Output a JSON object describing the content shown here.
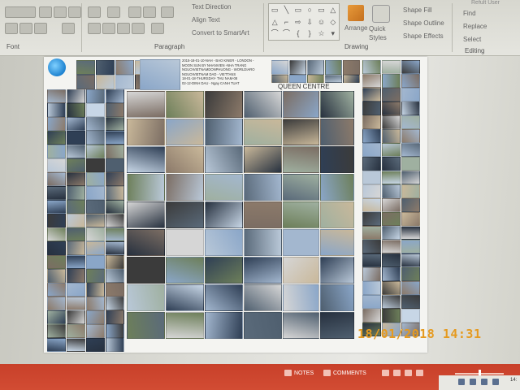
{
  "window": {
    "account_label": "Refult User"
  },
  "ribbon": {
    "groups": {
      "font": "Font",
      "paragraph": "Paragraph",
      "drawing": "Drawing",
      "editing": "Editing"
    },
    "paragraph": {
      "text_direction": "Text Direction",
      "align_text": "Align Text",
      "convert_smartart": "Convert to SmartArt"
    },
    "drawing": {
      "arrange": "Arrange",
      "quick_styles": "Quick Styles",
      "shape_fill": "Shape Fill",
      "shape_outline": "Shape Outline",
      "shape_effects": "Shape Effects"
    },
    "editing": {
      "find": "Find",
      "replace": "Replace",
      "select": "Select"
    }
  },
  "slide": {
    "header_lines": [
      "2015-18-01-10-NAH - BAO KINER - LONDON -",
      "MOON SUN BY NHANVIEN -NHA TRANG",
      "NGUOIVIETNAMDONPHUONG - WORLDIARO",
      "NGUOIVIETNAM DAD - VIETTANS",
      "18-01-18-THURSDAY- THU NAM-08",
      "02-12-DINH DAU - Ngay CANH TUAT"
    ],
    "caption": "QUEEN CENTRE"
  },
  "camera_stamp": "18/01/2018  14:31",
  "statusbar": {
    "notes": "NOTES",
    "comments": "COMMENTS"
  },
  "tray": {
    "time_partial": "14:"
  },
  "icons": {
    "globe": "globe-icon",
    "notes": "notes-icon",
    "comments": "comments-icon",
    "arrange": "arrange-icon",
    "quick_styles": "quick-styles-icon"
  },
  "colors": {
    "statusbar": "#d24c33",
    "stamp": "#e59a1f",
    "slide_bg": "#f4f4f1"
  }
}
